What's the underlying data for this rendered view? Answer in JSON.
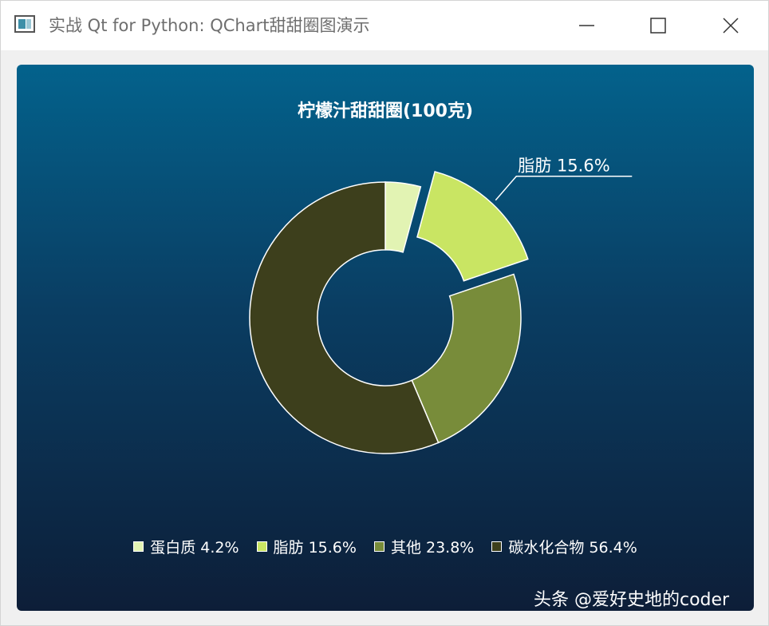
{
  "window": {
    "title": "实战 Qt for Python: QChart甜甜圈图演示"
  },
  "chart_data": {
    "type": "pie",
    "title": "柠檬汁甜甜圈(100克)",
    "hole_size": 0.35,
    "slices": [
      {
        "name": "蛋白质",
        "value": 4.2,
        "color": "#e2f3b3",
        "legend": "蛋白质 4.2%",
        "exploded": false
      },
      {
        "name": "脂肪",
        "value": 15.6,
        "color": "#c9e563",
        "legend": "脂肪 15.6%",
        "exploded": true,
        "label": "脂肪 15.6%"
      },
      {
        "name": "其他",
        "value": 23.8,
        "color": "#788c3a",
        "legend": "其他 23.8%",
        "exploded": false
      },
      {
        "name": "碳水化合物",
        "value": 56.4,
        "color": "#3d3f1c",
        "legend": "碳水化合物 56.4%",
        "exploded": false
      }
    ],
    "legend_position": "bottom"
  },
  "watermark": "头条 @爱好史地的coder"
}
